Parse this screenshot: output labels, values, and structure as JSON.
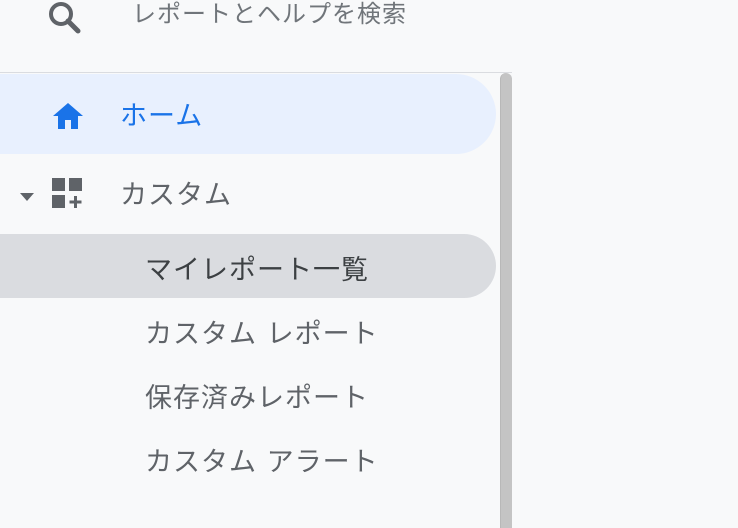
{
  "search": {
    "label": "レポートとヘルプを検索",
    "icon": "search-icon"
  },
  "nav": {
    "home": {
      "label": "ホーム",
      "icon": "home-icon",
      "active": true
    },
    "custom": {
      "label": "カスタム",
      "icon": "dashboard-add-icon",
      "expanded": true,
      "items": [
        {
          "label": "マイレポート一覧",
          "selected": true
        },
        {
          "label": "カスタム レポート"
        },
        {
          "label": "保存済みレポート"
        },
        {
          "label": "カスタム アラート"
        }
      ]
    }
  },
  "colors": {
    "accent": "#1a73e8",
    "active_bg": "#e8f0fe",
    "selected_bg": "#dadce0",
    "background": "#f8f9fa",
    "text": "#5f6368"
  }
}
